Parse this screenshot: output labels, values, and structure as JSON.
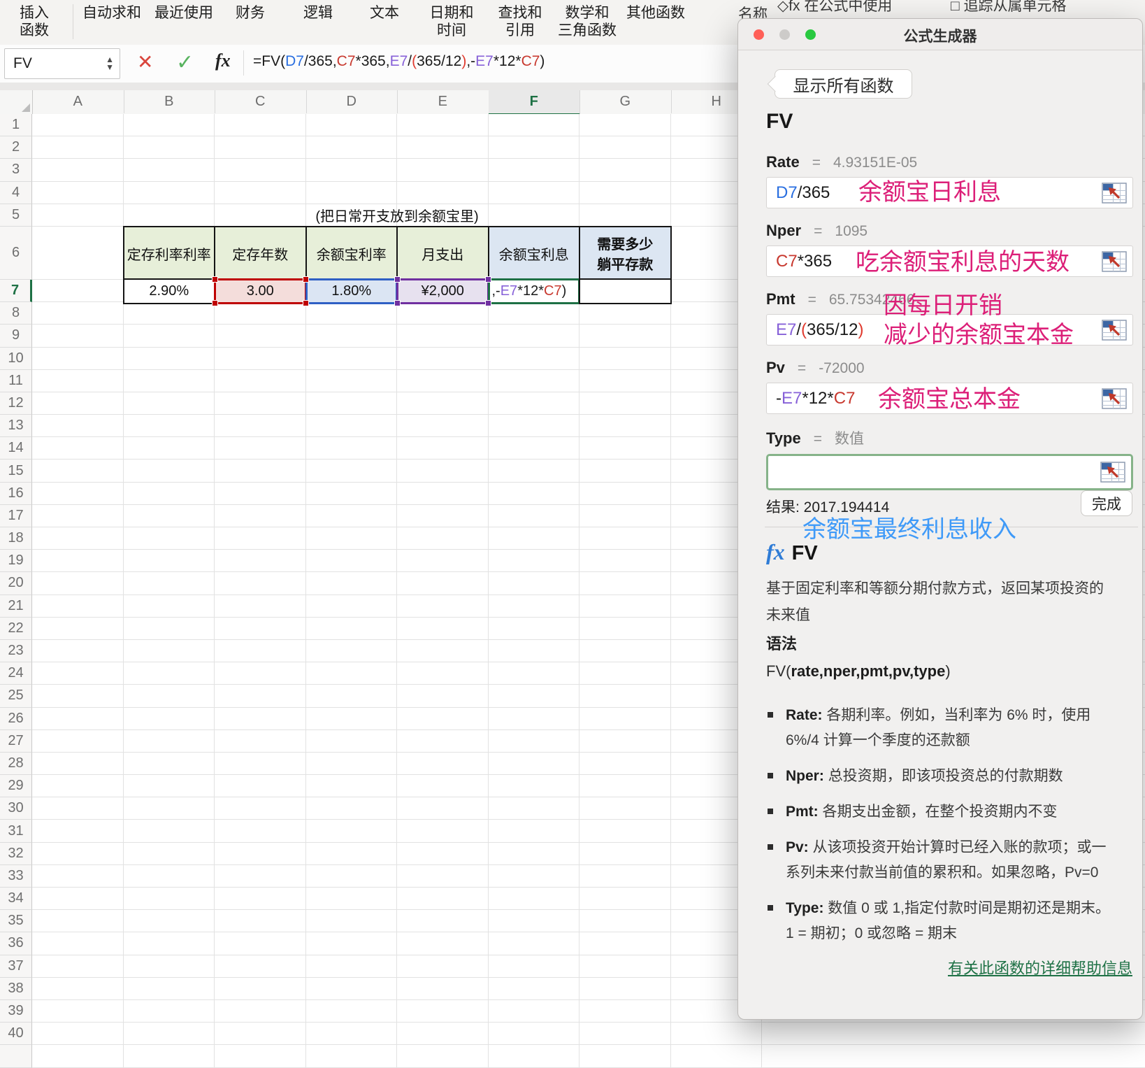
{
  "ribbon": {
    "items": [
      {
        "lines": [
          "插入",
          "函数"
        ]
      },
      {
        "lines": [
          "自动求和"
        ]
      },
      {
        "lines": [
          "最近使用"
        ]
      },
      {
        "lines": [
          "财务"
        ]
      },
      {
        "lines": [
          "逻辑"
        ]
      },
      {
        "lines": [
          "文本"
        ]
      },
      {
        "lines": [
          "日期和",
          "时间"
        ]
      },
      {
        "lines": [
          "查找和",
          "引用"
        ]
      },
      {
        "lines": [
          "数学和",
          "三角函数"
        ]
      },
      {
        "lines": [
          "其他函数"
        ]
      }
    ],
    "fragments": {
      "define_name": "名称",
      "use_in_formula": "◇fx 在公式中使用",
      "trace_dependents": "□ 追踪从属单元格"
    }
  },
  "formula_bar": {
    "name_box": "FV",
    "formula_segments": [
      {
        "t": "=FV(",
        "c": "black"
      },
      {
        "t": "D7",
        "c": "blue"
      },
      {
        "t": "/365,",
        "c": "black"
      },
      {
        "t": "C7",
        "c": "red"
      },
      {
        "t": "*365,",
        "c": "black"
      },
      {
        "t": "E7",
        "c": "purple"
      },
      {
        "t": "/",
        "c": "black"
      },
      {
        "t": "(",
        "c": "redp"
      },
      {
        "t": "365/12",
        "c": "black"
      },
      {
        "t": ")",
        "c": "redp"
      },
      {
        "t": ",-",
        "c": "black"
      },
      {
        "t": "E7",
        "c": "purple"
      },
      {
        "t": "*12*",
        "c": "black"
      },
      {
        "t": "C7",
        "c": "red"
      },
      {
        "t": ")",
        "c": "black"
      }
    ]
  },
  "sheet": {
    "columns": [
      "A",
      "B",
      "C",
      "D",
      "E",
      "F",
      "G",
      "H"
    ],
    "selected_column": "F",
    "rows": [
      1,
      2,
      3,
      4,
      5,
      6,
      7,
      8,
      9,
      10,
      11,
      12,
      13,
      14,
      15,
      16,
      17,
      18,
      19,
      20,
      21,
      22,
      23,
      24,
      25,
      26,
      27,
      28,
      29,
      30,
      31,
      32,
      33,
      34,
      35,
      36,
      37,
      38,
      39,
      40
    ],
    "selected_row": 7,
    "title": "(把日常开支放到余额宝里)",
    "table": {
      "headers": [
        {
          "text": "定存利率利率",
          "style": "green"
        },
        {
          "text": "定存年数",
          "style": "green"
        },
        {
          "text": "余额宝利率",
          "style": "green"
        },
        {
          "text": "月支出",
          "style": "green"
        },
        {
          "text": "余额宝利息",
          "style": "blue"
        },
        {
          "lines": [
            "需要多少",
            "躺平存款"
          ],
          "style": "blue-bold"
        }
      ],
      "values": [
        {
          "cell": "B7",
          "text": "2.90%",
          "style": "plain"
        },
        {
          "cell": "C7",
          "text": "3.00",
          "style": "red"
        },
        {
          "cell": "D7",
          "text": "1.80%",
          "style": "blue"
        },
        {
          "cell": "E7",
          "text": "¥2,000",
          "style": "purple"
        },
        {
          "cell": "F7",
          "style": "edit",
          "segments": [
            {
              "t": ",-",
              "c": "black"
            },
            {
              "t": "E7",
              "c": "purple"
            },
            {
              "t": "*12*",
              "c": "black"
            },
            {
              "t": "C7",
              "c": "red"
            },
            {
              "t": ")",
              "c": "black"
            }
          ]
        },
        {
          "cell": "G7",
          "text": "",
          "style": "plain"
        }
      ]
    }
  },
  "panel": {
    "title": "公式生成器",
    "back_button": "显示所有函数",
    "function_name": "FV",
    "args": [
      {
        "name": "Rate",
        "eq": "=",
        "value": "4.93151E-05",
        "expr": [
          {
            "t": "D7",
            "c": "blue"
          },
          {
            "t": "/365",
            "c": "black"
          }
        ],
        "annotation": {
          "text": "余额宝日利息"
        }
      },
      {
        "name": "Nper",
        "eq": "=",
        "value": "1095",
        "expr": [
          {
            "t": "C7",
            "c": "red"
          },
          {
            "t": "*365",
            "c": "black"
          }
        ],
        "annotation": {
          "text": "吃余额宝利息的天数"
        }
      },
      {
        "name": "Pmt",
        "eq": "=",
        "value": "65.75342466",
        "expr": [
          {
            "t": "E7",
            "c": "purple"
          },
          {
            "t": "/",
            "c": "black"
          },
          {
            "t": "(",
            "c": "redp"
          },
          {
            "t": "365/12",
            "c": "black"
          },
          {
            "t": ")",
            "c": "redp"
          }
        ],
        "annotation": {
          "lines": [
            "因每日开销",
            "减少的余额宝本金"
          ]
        }
      },
      {
        "name": "Pv",
        "eq": "=",
        "value": "-72000",
        "expr": [
          {
            "t": "-",
            "c": "black"
          },
          {
            "t": "E7",
            "c": "purple"
          },
          {
            "t": "*12*",
            "c": "black"
          },
          {
            "t": "C7",
            "c": "red"
          }
        ],
        "annotation": {
          "text": "余额宝总本金"
        }
      },
      {
        "name": "Type",
        "eq": "=",
        "value": "数值",
        "expr": [],
        "focused": true
      }
    ],
    "result_label": "结果: 2017.194414",
    "done_button": "完成",
    "result_annotation": "余额宝最终利息收入",
    "doc": {
      "fx_heading": "FV",
      "description": "基于固定利率和等额分期付款方式，返回某项投资的未来值",
      "syntax_heading": "语法",
      "signature_prefix": "FV(",
      "signature_args": "rate,nper,pmt,pv,type",
      "signature_suffix": ")",
      "params": [
        {
          "name": "Rate",
          "desc": "各期利率。例如，当利率为 6% 时，使用 6%/4 计算一个季度的还款额"
        },
        {
          "name": "Nper",
          "desc": "总投资期，即该项投资总的付款期数"
        },
        {
          "name": "Pmt",
          "desc": "各期支出金额，在整个投资期内不变"
        },
        {
          "name": "Pv",
          "desc": "从该项投资开始计算时已经入账的款项；或一系列未来付款当前值的累积和。如果忽略，Pv=0"
        },
        {
          "name": "Type",
          "desc": "数值 0 或 1,指定付款时间是期初还是期末。1 = 期初；0 或忽略 = 期末"
        }
      ],
      "help_link": "有关此函数的详细帮助信息"
    }
  },
  "colors": {
    "refs": {
      "black": "#1b1b1b",
      "blue": "#2a6fe0",
      "red": "#c8392f",
      "purple": "#8761d8",
      "redp": "#e03a2e"
    },
    "accent_green": "#1e7145",
    "annotation_pink": "#dc1f78",
    "annotation_blue": "#3f9af8",
    "cell_fill_green": "#e7efd9",
    "cell_fill_blue": "#dce6f2",
    "cell_fill_red": "#f4dddb",
    "cell_fill_lightblue": "#dbe5f3",
    "cell_fill_purple": "#e7e1ef",
    "border_red": "#bf0000",
    "border_blue": "#2f5fc4",
    "border_purple": "#7030a0",
    "traffic_lights": [
      "#ff5f57",
      "#cdcbc9",
      "#29c940"
    ]
  }
}
